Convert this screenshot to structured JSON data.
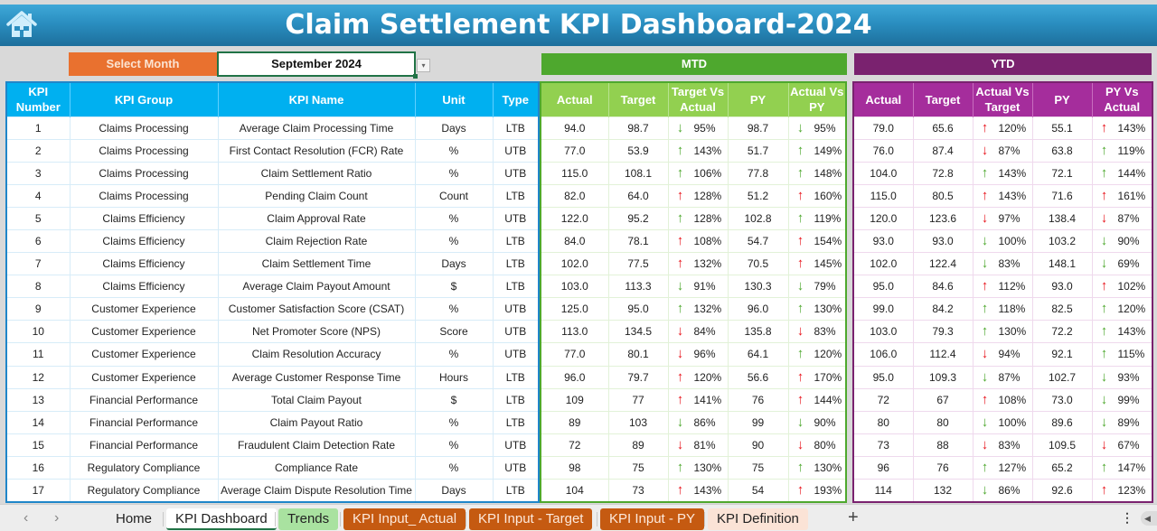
{
  "header": {
    "title": "Claim Settlement KPI Dashboard-2024",
    "home_icon": "home-icon"
  },
  "selector": {
    "label": "Select Month",
    "value": "September 2024",
    "dropdown_icon": "▾"
  },
  "bands": {
    "mtd": "MTD",
    "ytd": "YTD"
  },
  "main_headers": [
    "KPI Number",
    "KPI Group",
    "KPI Name",
    "Unit",
    "Type"
  ],
  "mtd_headers": [
    "Actual",
    "Target",
    "Target Vs Actual",
    "PY",
    "Actual Vs PY"
  ],
  "ytd_headers": [
    "Actual",
    "Target",
    "Actual Vs Target",
    "PY",
    "PY Vs Actual"
  ],
  "colors": {
    "up_good": "#4ea82e",
    "down_bad": "#e8141c",
    "mtd": "#4ea82e",
    "ytd": "#7a226f",
    "kpi": "#00b0f0"
  },
  "rows": [
    {
      "num": "1",
      "group": "Claims Processing",
      "name": "Average Claim Processing Time",
      "unit": "Days",
      "type": "LTB",
      "mtd": {
        "actual": "94.0",
        "target": "98.7",
        "tva": "95%",
        "tva_dir": "down",
        "tva_color": "green",
        "py": "98.7",
        "avp": "95%",
        "avp_dir": "down",
        "avp_color": "green"
      },
      "ytd": {
        "actual": "79.0",
        "target": "65.6",
        "avt": "120%",
        "avt_dir": "up",
        "avt_color": "red",
        "py": "55.1",
        "pva": "143%",
        "pva_dir": "up",
        "pva_color": "red"
      }
    },
    {
      "num": "2",
      "group": "Claims Processing",
      "name": "First Contact Resolution (FCR) Rate",
      "unit": "%",
      "type": "UTB",
      "mtd": {
        "actual": "77.0",
        "target": "53.9",
        "tva": "143%",
        "tva_dir": "up",
        "tva_color": "green",
        "py": "51.7",
        "avp": "149%",
        "avp_dir": "up",
        "avp_color": "green"
      },
      "ytd": {
        "actual": "76.0",
        "target": "87.4",
        "avt": "87%",
        "avt_dir": "down",
        "avt_color": "red",
        "py": "63.8",
        "pva": "119%",
        "pva_dir": "up",
        "pva_color": "green"
      }
    },
    {
      "num": "3",
      "group": "Claims Processing",
      "name": "Claim Settlement Ratio",
      "unit": "%",
      "type": "UTB",
      "mtd": {
        "actual": "115.0",
        "target": "108.1",
        "tva": "106%",
        "tva_dir": "up",
        "tva_color": "green",
        "py": "77.8",
        "avp": "148%",
        "avp_dir": "up",
        "avp_color": "green"
      },
      "ytd": {
        "actual": "104.0",
        "target": "72.8",
        "avt": "143%",
        "avt_dir": "up",
        "avt_color": "green",
        "py": "72.1",
        "pva": "144%",
        "pva_dir": "up",
        "pva_color": "green"
      }
    },
    {
      "num": "4",
      "group": "Claims Processing",
      "name": "Pending Claim Count",
      "unit": "Count",
      "type": "LTB",
      "mtd": {
        "actual": "82.0",
        "target": "64.0",
        "tva": "128%",
        "tva_dir": "up",
        "tva_color": "red",
        "py": "51.2",
        "avp": "160%",
        "avp_dir": "up",
        "avp_color": "red"
      },
      "ytd": {
        "actual": "115.0",
        "target": "80.5",
        "avt": "143%",
        "avt_dir": "up",
        "avt_color": "red",
        "py": "71.6",
        "pva": "161%",
        "pva_dir": "up",
        "pva_color": "red"
      }
    },
    {
      "num": "5",
      "group": "Claims Efficiency",
      "name": "Claim Approval Rate",
      "unit": "%",
      "type": "UTB",
      "mtd": {
        "actual": "122.0",
        "target": "95.2",
        "tva": "128%",
        "tva_dir": "up",
        "tva_color": "green",
        "py": "102.8",
        "avp": "119%",
        "avp_dir": "up",
        "avp_color": "green"
      },
      "ytd": {
        "actual": "120.0",
        "target": "123.6",
        "avt": "97%",
        "avt_dir": "down",
        "avt_color": "red",
        "py": "138.4",
        "pva": "87%",
        "pva_dir": "down",
        "pva_color": "red"
      }
    },
    {
      "num": "6",
      "group": "Claims Efficiency",
      "name": "Claim Rejection Rate",
      "unit": "%",
      "type": "LTB",
      "mtd": {
        "actual": "84.0",
        "target": "78.1",
        "tva": "108%",
        "tva_dir": "up",
        "tva_color": "red",
        "py": "54.7",
        "avp": "154%",
        "avp_dir": "up",
        "avp_color": "red"
      },
      "ytd": {
        "actual": "93.0",
        "target": "93.0",
        "avt": "100%",
        "avt_dir": "down",
        "avt_color": "green",
        "py": "103.2",
        "pva": "90%",
        "pva_dir": "down",
        "pva_color": "green"
      }
    },
    {
      "num": "7",
      "group": "Claims Efficiency",
      "name": "Claim Settlement Time",
      "unit": "Days",
      "type": "LTB",
      "mtd": {
        "actual": "102.0",
        "target": "77.5",
        "tva": "132%",
        "tva_dir": "up",
        "tva_color": "red",
        "py": "70.5",
        "avp": "145%",
        "avp_dir": "up",
        "avp_color": "red"
      },
      "ytd": {
        "actual": "102.0",
        "target": "122.4",
        "avt": "83%",
        "avt_dir": "down",
        "avt_color": "green",
        "py": "148.1",
        "pva": "69%",
        "pva_dir": "down",
        "pva_color": "green"
      }
    },
    {
      "num": "8",
      "group": "Claims Efficiency",
      "name": "Average Claim Payout Amount",
      "unit": "$",
      "type": "LTB",
      "mtd": {
        "actual": "103.0",
        "target": "113.3",
        "tva": "91%",
        "tva_dir": "down",
        "tva_color": "green",
        "py": "130.3",
        "avp": "79%",
        "avp_dir": "down",
        "avp_color": "green"
      },
      "ytd": {
        "actual": "95.0",
        "target": "84.6",
        "avt": "112%",
        "avt_dir": "up",
        "avt_color": "red",
        "py": "93.0",
        "pva": "102%",
        "pva_dir": "up",
        "pva_color": "red"
      }
    },
    {
      "num": "9",
      "group": "Customer Experience",
      "name": "Customer Satisfaction Score (CSAT)",
      "unit": "%",
      "type": "UTB",
      "mtd": {
        "actual": "125.0",
        "target": "95.0",
        "tva": "132%",
        "tva_dir": "up",
        "tva_color": "green",
        "py": "96.0",
        "avp": "130%",
        "avp_dir": "up",
        "avp_color": "green"
      },
      "ytd": {
        "actual": "99.0",
        "target": "84.2",
        "avt": "118%",
        "avt_dir": "up",
        "avt_color": "green",
        "py": "82.5",
        "pva": "120%",
        "pva_dir": "up",
        "pva_color": "green"
      }
    },
    {
      "num": "10",
      "group": "Customer Experience",
      "name": "Net Promoter Score (NPS)",
      "unit": "Score",
      "type": "UTB",
      "mtd": {
        "actual": "113.0",
        "target": "134.5",
        "tva": "84%",
        "tva_dir": "down",
        "tva_color": "red",
        "py": "135.8",
        "avp": "83%",
        "avp_dir": "down",
        "avp_color": "red"
      },
      "ytd": {
        "actual": "103.0",
        "target": "79.3",
        "avt": "130%",
        "avt_dir": "up",
        "avt_color": "green",
        "py": "72.2",
        "pva": "143%",
        "pva_dir": "up",
        "pva_color": "green"
      }
    },
    {
      "num": "11",
      "group": "Customer Experience",
      "name": "Claim Resolution Accuracy",
      "unit": "%",
      "type": "UTB",
      "mtd": {
        "actual": "77.0",
        "target": "80.1",
        "tva": "96%",
        "tva_dir": "down",
        "tva_color": "red",
        "py": "64.1",
        "avp": "120%",
        "avp_dir": "up",
        "avp_color": "green"
      },
      "ytd": {
        "actual": "106.0",
        "target": "112.4",
        "avt": "94%",
        "avt_dir": "down",
        "avt_color": "red",
        "py": "92.1",
        "pva": "115%",
        "pva_dir": "up",
        "pva_color": "green"
      }
    },
    {
      "num": "12",
      "group": "Customer Experience",
      "name": "Average Customer Response Time",
      "unit": "Hours",
      "type": "LTB",
      "mtd": {
        "actual": "96.0",
        "target": "79.7",
        "tva": "120%",
        "tva_dir": "up",
        "tva_color": "red",
        "py": "56.6",
        "avp": "170%",
        "avp_dir": "up",
        "avp_color": "red"
      },
      "ytd": {
        "actual": "95.0",
        "target": "109.3",
        "avt": "87%",
        "avt_dir": "down",
        "avt_color": "green",
        "py": "102.7",
        "pva": "93%",
        "pva_dir": "down",
        "pva_color": "green"
      }
    },
    {
      "num": "13",
      "group": "Financial Performance",
      "name": "Total Claim Payout",
      "unit": "$",
      "type": "LTB",
      "mtd": {
        "actual": "109",
        "target": "77",
        "tva": "141%",
        "tva_dir": "up",
        "tva_color": "red",
        "py": "76",
        "avp": "144%",
        "avp_dir": "up",
        "avp_color": "red"
      },
      "ytd": {
        "actual": "72",
        "target": "67",
        "avt": "108%",
        "avt_dir": "up",
        "avt_color": "red",
        "py": "73.0",
        "pva": "99%",
        "pva_dir": "down",
        "pva_color": "green"
      }
    },
    {
      "num": "14",
      "group": "Financial Performance",
      "name": "Claim Payout Ratio",
      "unit": "%",
      "type": "LTB",
      "mtd": {
        "actual": "89",
        "target": "103",
        "tva": "86%",
        "tva_dir": "down",
        "tva_color": "green",
        "py": "99",
        "avp": "90%",
        "avp_dir": "down",
        "avp_color": "green"
      },
      "ytd": {
        "actual": "80",
        "target": "80",
        "avt": "100%",
        "avt_dir": "down",
        "avt_color": "green",
        "py": "89.6",
        "pva": "89%",
        "pva_dir": "down",
        "pva_color": "green"
      }
    },
    {
      "num": "15",
      "group": "Financial Performance",
      "name": "Fraudulent Claim Detection Rate",
      "unit": "%",
      "type": "UTB",
      "mtd": {
        "actual": "72",
        "target": "89",
        "tva": "81%",
        "tva_dir": "down",
        "tva_color": "red",
        "py": "90",
        "avp": "80%",
        "avp_dir": "down",
        "avp_color": "red"
      },
      "ytd": {
        "actual": "73",
        "target": "88",
        "avt": "83%",
        "avt_dir": "down",
        "avt_color": "red",
        "py": "109.5",
        "pva": "67%",
        "pva_dir": "down",
        "pva_color": "red"
      }
    },
    {
      "num": "16",
      "group": "Regulatory Compliance",
      "name": "Compliance Rate",
      "unit": "%",
      "type": "UTB",
      "mtd": {
        "actual": "98",
        "target": "75",
        "tva": "130%",
        "tva_dir": "up",
        "tva_color": "green",
        "py": "75",
        "avp": "130%",
        "avp_dir": "up",
        "avp_color": "green"
      },
      "ytd": {
        "actual": "96",
        "target": "76",
        "avt": "127%",
        "avt_dir": "up",
        "avt_color": "green",
        "py": "65.2",
        "pva": "147%",
        "pva_dir": "up",
        "pva_color": "green"
      }
    },
    {
      "num": "17",
      "group": "Regulatory Compliance",
      "name": "Average Claim Dispute Resolution Time",
      "unit": "Days",
      "type": "LTB",
      "mtd": {
        "actual": "104",
        "target": "73",
        "tva": "143%",
        "tva_dir": "up",
        "tva_color": "red",
        "py": "54",
        "avp": "193%",
        "avp_dir": "up",
        "avp_color": "red"
      },
      "ytd": {
        "actual": "114",
        "target": "132",
        "avt": "86%",
        "avt_dir": "down",
        "avt_color": "green",
        "py": "92.6",
        "pva": "123%",
        "pva_dir": "up",
        "pva_color": "red"
      }
    }
  ],
  "tabs": {
    "prev": "‹",
    "next": "›",
    "items": [
      {
        "label": "Home",
        "style": "plain"
      },
      {
        "label": "KPI Dashboard",
        "style": "active"
      },
      {
        "label": "Trends",
        "style": "green"
      },
      {
        "label": "KPI Input_ Actual",
        "style": "orange"
      },
      {
        "label": "KPI Input - Target",
        "style": "orange"
      },
      {
        "label": "KPI Input - PY",
        "style": "orange"
      },
      {
        "label": "KPI Definition",
        "style": "peach"
      }
    ],
    "add": "+",
    "more": "⋮",
    "scroll": "◀"
  }
}
